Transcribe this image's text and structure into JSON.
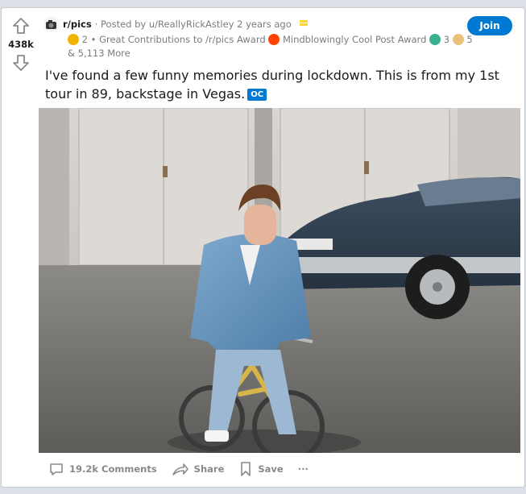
{
  "post": {
    "vote_count": "438k",
    "subreddit": "r/pics",
    "posted_by": "· Posted by u/ReallyRickAstley 2 years ago",
    "awards": {
      "count1": "2",
      "sep": "•",
      "award1": "Great Contributions to /r/pics Award",
      "award2": "Mindblowingly Cool Post Award",
      "count3": "3",
      "count4": "5",
      "more": "& 5,113 More"
    },
    "join_label": "Join",
    "title": "I've found a few funny memories during lockdown. This is from my 1st tour in 89, backstage in Vegas.",
    "flair": "OC",
    "comments_label": "19.2k Comments",
    "share_label": "Share",
    "save_label": "Save",
    "more_label": "···"
  },
  "colors": {
    "accent": "#0079d3",
    "background": "#dae0e6",
    "meta_text": "#787c7e"
  }
}
